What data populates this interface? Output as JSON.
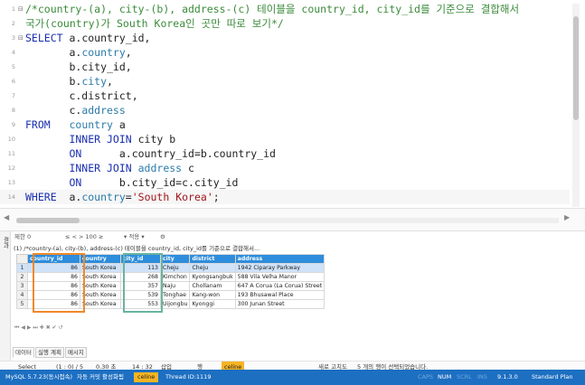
{
  "editor": {
    "lines": [
      {
        "num": "1",
        "fold": "⊟",
        "parts": [
          {
            "c": "cm",
            "t": "/*country-(a), city-(b), address-(c) 테이블을 country_id, city_id를 기준으로 결합해서"
          }
        ]
      },
      {
        "num": "2",
        "fold": "",
        "parts": [
          {
            "c": "cm",
            "t": "국가(country)가 South Korea인 곳만 따로 보기*/"
          }
        ]
      },
      {
        "num": "3",
        "fold": "⊟",
        "parts": [
          {
            "c": "kw",
            "t": "SELECT "
          },
          {
            "c": "id",
            "t": "a.country_id,"
          }
        ]
      },
      {
        "num": "4",
        "fold": "",
        "parts": [
          {
            "c": "id",
            "t": "       a."
          },
          {
            "c": "fld",
            "t": "country"
          },
          {
            "c": "id",
            "t": ","
          }
        ]
      },
      {
        "num": "5",
        "fold": "",
        "parts": [
          {
            "c": "id",
            "t": "       b.city_id,"
          }
        ]
      },
      {
        "num": "6",
        "fold": "",
        "parts": [
          {
            "c": "id",
            "t": "       b."
          },
          {
            "c": "fld",
            "t": "city"
          },
          {
            "c": "id",
            "t": ","
          }
        ]
      },
      {
        "num": "7",
        "fold": "",
        "parts": [
          {
            "c": "id",
            "t": "       c.district,"
          }
        ]
      },
      {
        "num": "8",
        "fold": "",
        "parts": [
          {
            "c": "id",
            "t": "       c."
          },
          {
            "c": "fld",
            "t": "address"
          }
        ]
      },
      {
        "num": "9",
        "fold": "",
        "parts": [
          {
            "c": "kw",
            "t": "FROM   "
          },
          {
            "c": "fld",
            "t": "country"
          },
          {
            "c": "id",
            "t": " a"
          }
        ]
      },
      {
        "num": "10",
        "fold": "",
        "parts": [
          {
            "c": "kw",
            "t": "       INNER JOIN "
          },
          {
            "c": "id",
            "t": "city b"
          }
        ]
      },
      {
        "num": "11",
        "fold": "",
        "parts": [
          {
            "c": "kw",
            "t": "       ON      "
          },
          {
            "c": "id",
            "t": "a.country_id=b.country_id"
          }
        ]
      },
      {
        "num": "12",
        "fold": "",
        "parts": [
          {
            "c": "kw",
            "t": "       INNER JOIN "
          },
          {
            "c": "fld",
            "t": "address"
          },
          {
            "c": "id",
            "t": " c"
          }
        ]
      },
      {
        "num": "13",
        "fold": "",
        "parts": [
          {
            "c": "kw",
            "t": "       ON      "
          },
          {
            "c": "id",
            "t": "b.city_id=c.city_id"
          }
        ]
      },
      {
        "num": "14",
        "fold": "",
        "parts": [
          {
            "c": "kw",
            "t": "WHERE  "
          },
          {
            "c": "id",
            "t": "a."
          },
          {
            "c": "fld",
            "t": "country"
          },
          {
            "c": "id",
            "t": "="
          },
          {
            "c": "str",
            "t": "'South Korea'"
          },
          {
            "c": "id",
            "t": ";"
          }
        ]
      }
    ]
  },
  "results": {
    "side_label": "결과",
    "toolbar": {
      "limit": "제한 0",
      "nav": "≤ < > 100 ≥",
      "filter": "▾ 적용 ▾",
      "gear": "⚙"
    },
    "query_text": "(1) /*country-(a), city-(b), address-(c) 테이블을 country_id, city_id를 기준으로 결합해서...",
    "columns": [
      "country_id",
      "country",
      "city_id",
      "city",
      "district",
      "address"
    ],
    "rows": [
      {
        "rn": "1",
        "cells": [
          "86",
          "South Korea",
          "113",
          "Cheju",
          "Cheju",
          "1942 Ciparay Parkway"
        ]
      },
      {
        "rn": "2",
        "cells": [
          "86",
          "South Korea",
          "268",
          "Kimchon",
          "Kyongsangbuk",
          "588 Vila Velha Manor"
        ]
      },
      {
        "rn": "3",
        "cells": [
          "86",
          "South Korea",
          "357",
          "Naju",
          "Chollanam",
          "647 A Corua (La Corua) Street"
        ]
      },
      {
        "rn": "4",
        "cells": [
          "86",
          "South Korea",
          "539",
          "Tonghae",
          "Kang-won",
          "193 Bhusawal Place"
        ]
      },
      {
        "rn": "5",
        "cells": [
          "86",
          "South Korea",
          "553",
          "Uijongbu",
          "Kyonggi",
          "300 Junan Street"
        ]
      }
    ],
    "grid_footer": "⏮ ◀ ▶ ⏭ ✚ ✖ ✔ ↺",
    "sub_tabs": [
      "데이터",
      "실행 계획",
      "메시지"
    ]
  },
  "info_bar": {
    "select": "Select",
    "rows": "(1 : 0) / 5",
    "time1": "0.30 초",
    "time2": "14 : 32",
    "insert": "삽입",
    "mode": "행",
    "badge": "celine",
    "refresh": "새로 고치도",
    "selected": "5 개의 행이 선택되었습니다."
  },
  "status": {
    "server": "MySQL 5.7.23(동시접속)",
    "autocommit": "자동 커밋 활성화됨",
    "badge": "celine",
    "thread": "Thread ID:1119",
    "caps": "CAPS",
    "num": "NUM",
    "scrl": "SCRL",
    "ins": "INS",
    "version": "9.1.3.0",
    "plan": "Standard Plan"
  }
}
